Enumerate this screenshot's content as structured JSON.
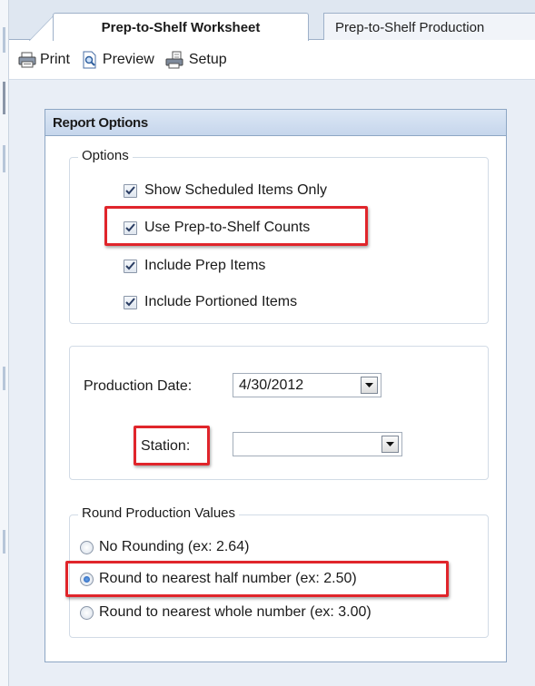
{
  "tabs": [
    {
      "label": "Prep-to-Shelf Worksheet",
      "active": true
    },
    {
      "label": "Prep-to-Shelf Production",
      "active": false
    }
  ],
  "toolbar": {
    "print_label": "Print",
    "preview_label": "Preview",
    "setup_label": "Setup"
  },
  "panel": {
    "title": "Report Options",
    "options_group": {
      "legend": "Options",
      "items": [
        {
          "label": "Show Scheduled Items Only",
          "checked": true
        },
        {
          "label": "Use Prep-to-Shelf Counts",
          "checked": true
        },
        {
          "label": "Include Prep Items",
          "checked": true
        },
        {
          "label": "Include Portioned Items",
          "checked": true
        }
      ]
    },
    "date_group": {
      "production_date_label": "Production Date:",
      "production_date_value": "4/30/2012",
      "station_label": "Station:",
      "station_value": ""
    },
    "rounding_group": {
      "legend": "Round Production Values",
      "options": [
        {
          "label": "No Rounding (ex: 2.64)",
          "selected": false
        },
        {
          "label": "Round to nearest half number (ex: 2.50)",
          "selected": true
        },
        {
          "label": "Round to nearest whole number (ex: 3.00)",
          "selected": false
        }
      ]
    }
  },
  "colors": {
    "highlight": "#e0252b",
    "panel_border": "#8da6c4",
    "header_bg": "#c6d6ec"
  }
}
